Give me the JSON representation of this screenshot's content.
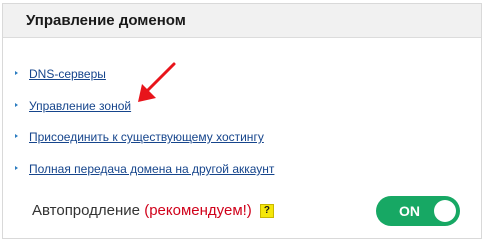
{
  "panel": {
    "title": "Управление доменом"
  },
  "links": [
    {
      "label": "DNS-серверы"
    },
    {
      "label": "Управление зоной"
    },
    {
      "label": "Присоединить к существующему хостингу"
    },
    {
      "label": "Полная передача домена на другой аккаунт"
    }
  ],
  "autorenew": {
    "label": "Автопродление",
    "recommendation": "(рекомендуем!)",
    "help": "?"
  },
  "toggle": {
    "state": "ON",
    "enabled": true
  },
  "colors": {
    "link": "#16458c",
    "bullet": "#2b7cc0",
    "recommendation": "#d0021b",
    "toggle_on": "#17a864",
    "help_badge": "#f5e70a",
    "annotation_arrow": "#e8141b"
  },
  "icons": [
    "link-bullet-icon",
    "red-arrow-icon",
    "help-question-icon",
    "toggle-knob-icon"
  ]
}
